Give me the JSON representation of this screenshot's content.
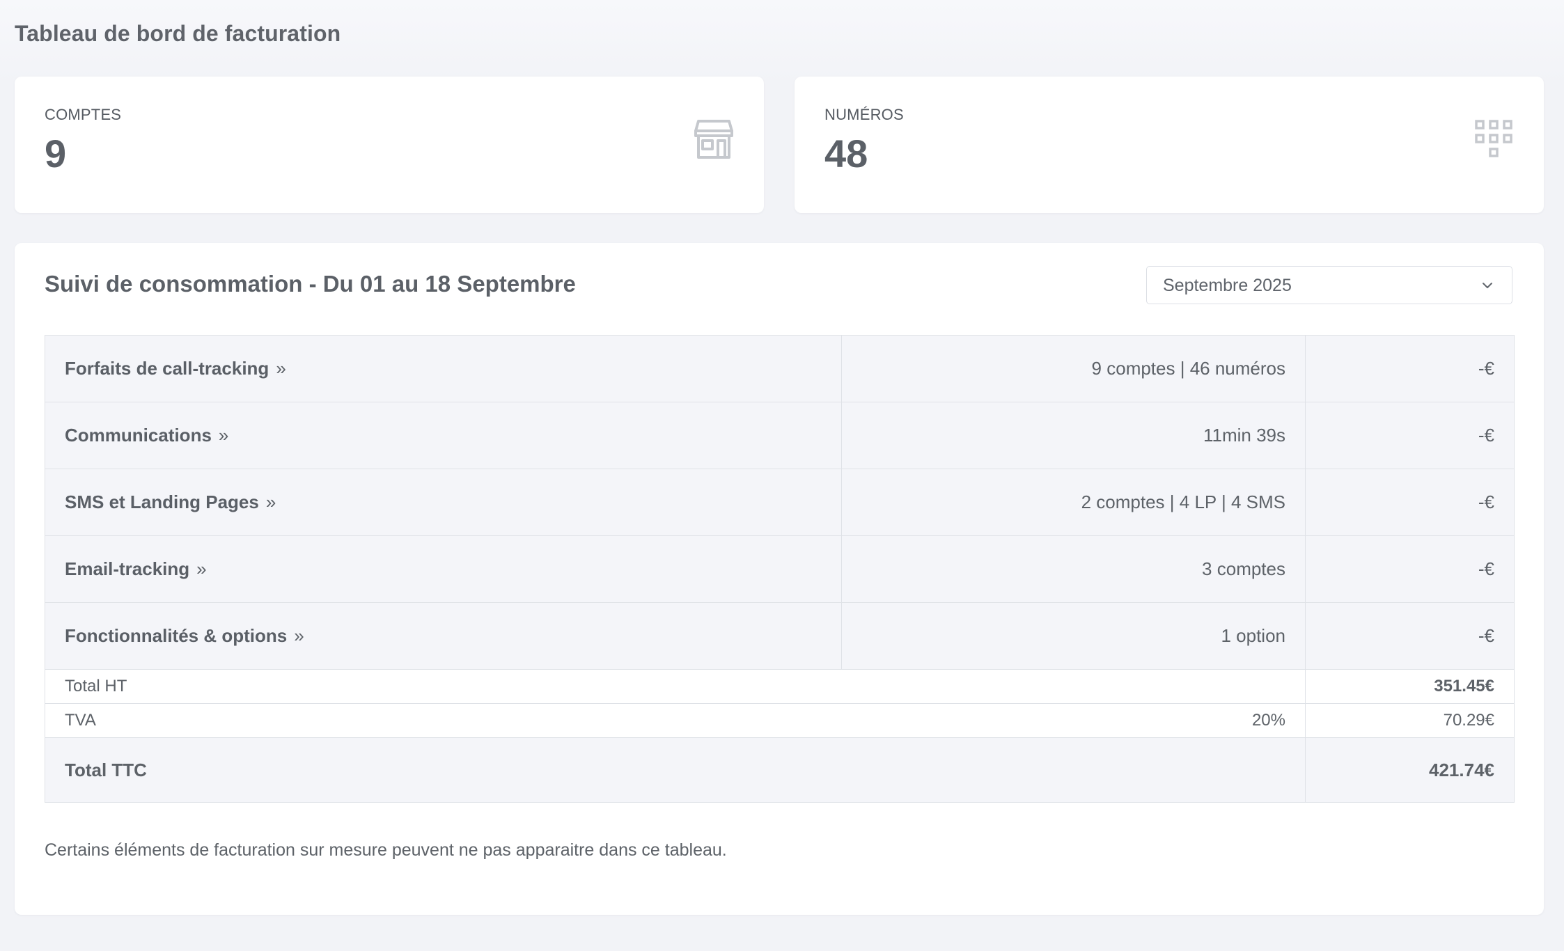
{
  "page": {
    "title": "Tableau de bord de facturation"
  },
  "stats": [
    {
      "label": "COMPTES",
      "value": "9",
      "icon": "store-icon"
    },
    {
      "label": "NUMÉROS",
      "value": "48",
      "icon": "grid-icon"
    }
  ],
  "consumption": {
    "title": "Suivi de consommation - Du 01 au 18 Septembre",
    "month_select": {
      "selected": "Septembre 2025"
    },
    "services": [
      {
        "label": "Forfaits de call-tracking",
        "detail": "9 comptes | 46 numéros",
        "amount": "-€"
      },
      {
        "label": "Communications",
        "detail": "11min 39s",
        "amount": "-€"
      },
      {
        "label": "SMS et Landing Pages",
        "detail": "2 comptes | 4 LP | 4 SMS",
        "amount": "-€"
      },
      {
        "label": "Email-tracking",
        "detail": "3 comptes",
        "amount": "-€"
      },
      {
        "label": "Fonctionnalités & options",
        "detail": "1 option",
        "amount": "-€"
      }
    ],
    "chevron_glyph": "»",
    "total_ht": {
      "label": "Total HT",
      "amount": "351.45€"
    },
    "tva": {
      "label": "TVA",
      "rate": "20%",
      "amount": "70.29€"
    },
    "total_ttc": {
      "label": "Total TTC",
      "amount": "421.74€"
    },
    "footnote": "Certains éléments de facturation sur mesure peuvent ne pas apparaitre dans ce tableau."
  },
  "colors": {
    "background": "#f3f4f8",
    "card": "#ffffff",
    "text": "#5b6169",
    "icon": "#c5c8cd",
    "border": "#dfe2e7"
  }
}
